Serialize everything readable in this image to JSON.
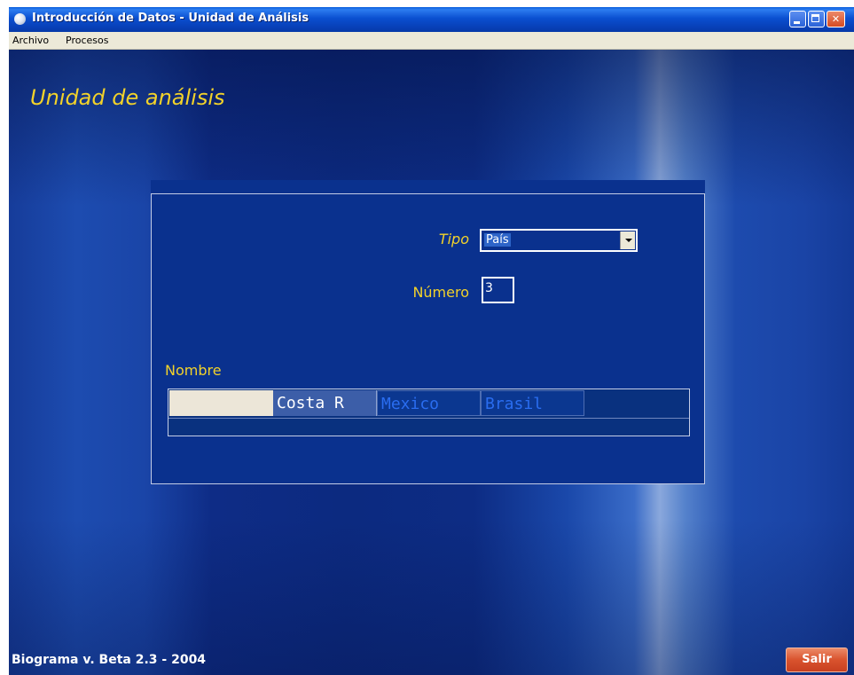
{
  "window": {
    "title": "Introducción de Datos - Unidad de Análisis",
    "buttons": {
      "minimize": "",
      "maximize": "",
      "close": "✕"
    }
  },
  "menu": {
    "items": [
      {
        "label": "Archivo"
      },
      {
        "label": "Procesos"
      }
    ]
  },
  "page": {
    "heading": "Unidad de análisis"
  },
  "form": {
    "tipo_label": "Tipo",
    "tipo_value": "País",
    "numero_label": "Número",
    "numero_value": "3",
    "nombre_label": "Nombre"
  },
  "grid": {
    "cells": [
      "",
      "Costa R",
      "Mexico",
      "Brasil"
    ]
  },
  "footer": {
    "version": "Biograma v. Beta 2.3 - 2004",
    "exit_label": "Salir"
  },
  "colors": {
    "accent_yellow": "#f2d22a",
    "background_blue": "#0c2f87",
    "exit_button": "#d9532e"
  }
}
